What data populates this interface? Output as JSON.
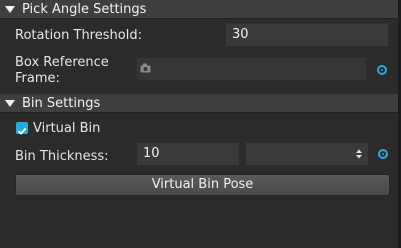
{
  "pick_angle_settings": {
    "header_title": "Pick Angle Settings",
    "rotation_threshold_label": "Rotation Threshold:",
    "rotation_threshold_value": "30",
    "box_reference_frame_label_line1": "Box Reference",
    "box_reference_frame_label_line2": "Frame:",
    "box_reference_frame_value": ""
  },
  "bin_settings": {
    "header_title": "Bin Settings",
    "virtual_bin_label": "Virtual Bin",
    "virtual_bin_checked": true,
    "bin_thickness_label": "Bin Thickness:",
    "bin_thickness_value": "10",
    "bin_thickness_select_value": "",
    "virtual_bin_pose_button": "Virtual Bin Pose"
  },
  "colors": {
    "accent": "#29a8e0",
    "background": "#2b2b2b",
    "header": "#3f3f3f"
  }
}
